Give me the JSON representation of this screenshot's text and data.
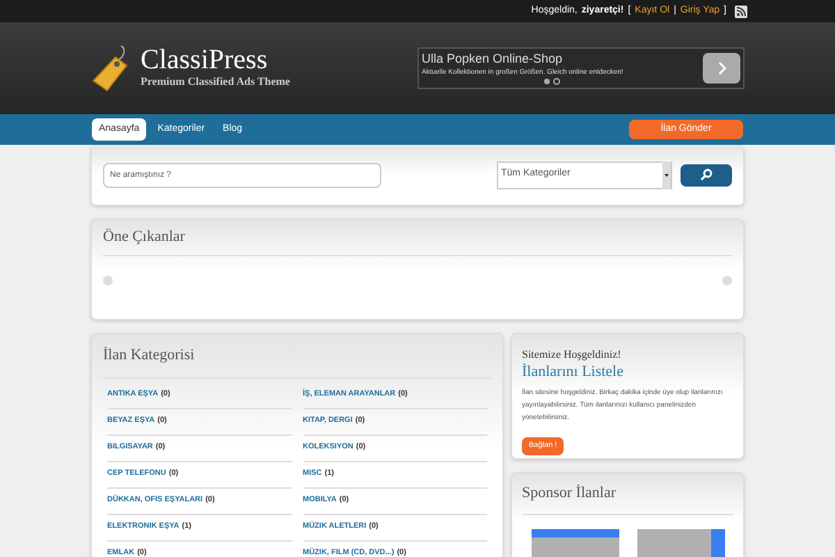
{
  "top_bar": {
    "greeting": "Hoşgeldin,",
    "user": "ziyaretçi!",
    "open_bracket": "[",
    "register": "Kayıt Ol",
    "separator": "|",
    "login": "Giriş Yap",
    "close_bracket": "]"
  },
  "logo": {
    "title": "ClassiPress",
    "tagline": "Premium Classified Ads Theme"
  },
  "ad": {
    "title": "Ulla Popken Online-Shop",
    "text": "Aktuelle Kollektionen in großen Größen. Gleich online entdecken!"
  },
  "nav": {
    "items": [
      {
        "label": "Anasayfa",
        "selected": true
      },
      {
        "label": "Kategoriler",
        "selected": false
      },
      {
        "label": "Blog",
        "selected": false
      }
    ],
    "cta": "İlan Gönder"
  },
  "search": {
    "placeholder": "Ne aramıştınız ?",
    "category": "Tüm Kategoriler"
  },
  "featured": {
    "title": "Öne Çıkanlar"
  },
  "categories": {
    "title": "İlan Kategorisi",
    "items": [
      {
        "name": "ANTIKA EŞYA",
        "count": "(0)"
      },
      {
        "name": "İŞ, ELEMAN ARAYANLAR",
        "count": "(0)"
      },
      {
        "name": "BEYAZ EŞYA",
        "count": "(0)"
      },
      {
        "name": "KITAP, DERGI",
        "count": "(0)"
      },
      {
        "name": "BILGISAYAR",
        "count": "(0)"
      },
      {
        "name": "KOLEKSIYON",
        "count": "(0)"
      },
      {
        "name": "CEP TELEFONU",
        "count": "(0)"
      },
      {
        "name": "MISC",
        "count": "(1)"
      },
      {
        "name": "DÜKKAN, OFIS EŞYALARI",
        "count": "(0)"
      },
      {
        "name": "MOBILYA",
        "count": "(0)"
      },
      {
        "name": "ELEKTRONIK EŞYA",
        "count": "(1)"
      },
      {
        "name": "MÜZIK ALETLERI",
        "count": "(0)"
      },
      {
        "name": "EMLAK",
        "count": "(0)"
      },
      {
        "name": "MÜZIK, FILM (CD, DVD...)",
        "count": "(0)"
      }
    ]
  },
  "welcome": {
    "heading": "Sitemize Hoşgeldiniz!",
    "subheading": "İlanlarını Listele",
    "text": "İlan sitesine hoşgeldiniz. Birkaç dakika içinde üye olup ilanlarınızı yayınlayabilirsiniz. Tüm ilanlarınızı kullanıcı panelinizden yönetebilirsiniz.",
    "button": "Bağlan !"
  },
  "sponsor": {
    "title": "Sponsor İlanlar"
  }
}
